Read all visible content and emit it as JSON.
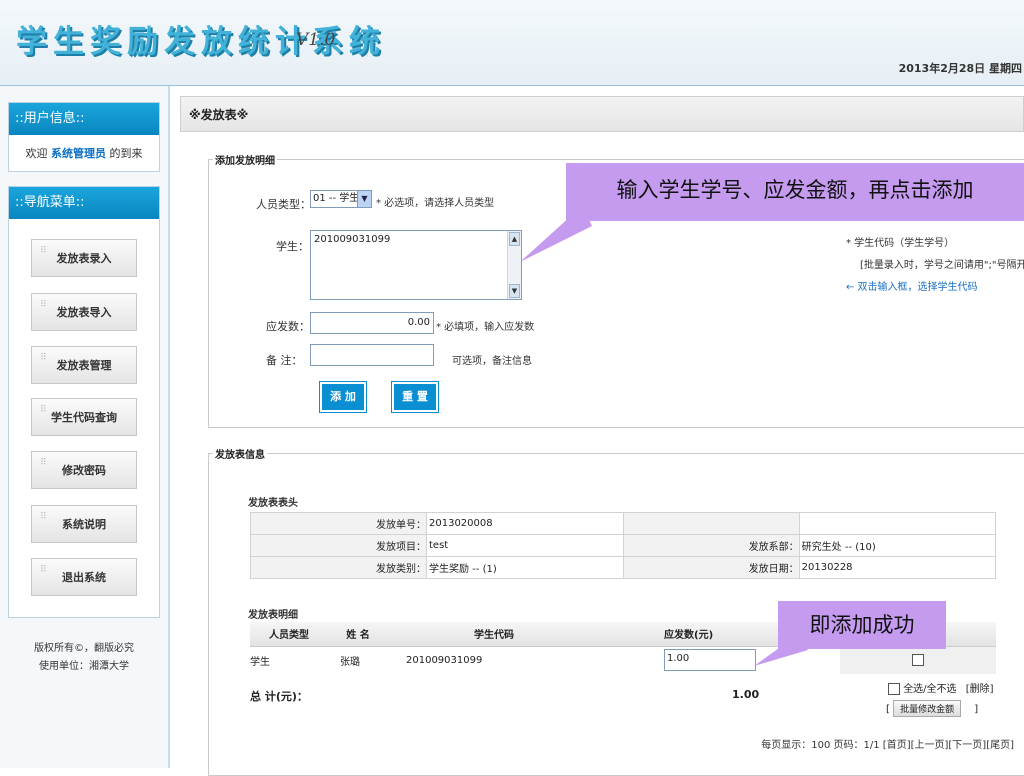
{
  "header": {
    "logo_text": "学生奖励发放统计系统",
    "version": "V1.0",
    "date": "2013年2月28日 星期四"
  },
  "sidebar": {
    "user_info_title": "::用户信息::",
    "welcome_prefix": "欢迎",
    "admin_name": "系统管理员",
    "welcome_suffix": "的到来",
    "nav_title": "::导航菜单::",
    "nav_items": [
      "发放表录入",
      "发放表导入",
      "发放表管理",
      "学生代码查询",
      "修改密码",
      "系统说明",
      "退出系统"
    ],
    "copyright": "版权所有©，翻版必究",
    "unit": "使用单位：湘潭大学"
  },
  "main": {
    "title": "※发放表※",
    "add_section": {
      "legend": "添加发放明细",
      "person_type_label": "人员类型：",
      "person_type_value": "01 -- 学生",
      "person_type_hint": "* 必选项，请选择人员类型",
      "student_label": "学生：",
      "student_value": "201009031099",
      "student_hint_1": "*  学生代码（学生学号）",
      "student_hint_2": "[批量录入时，学号之间请用\";\"号隔开]",
      "student_hint_3": "←  双击输入框，选择学生代码",
      "amount_label": "应发数：",
      "amount_value": "0.00",
      "amount_hint": "* 必填项，输入应发数",
      "remark_label": "备  注：",
      "remark_value": "",
      "remark_hint": "可选项，备注信息",
      "add_button": "添 加",
      "reset_button": "重 置"
    },
    "info_section": {
      "legend": "发放表信息",
      "header_title": "发放表表头",
      "rows": [
        {
          "k1": "发放单号：",
          "v1": "2013020008",
          "k2": "",
          "v2": ""
        },
        {
          "k1": "发放项目：",
          "v1": "test",
          "k2": "发放系部：",
          "v2": "研究生处 -- (10)"
        },
        {
          "k1": "发放类别：",
          "v1": "学生奖励 -- (1)",
          "k2": "发放日期：",
          "v2": "20130228"
        }
      ],
      "detail_title": "发放表明细",
      "columns": [
        "人员类型",
        "姓  名",
        "学生代码",
        "应发数(元)",
        ""
      ],
      "detail_rows": [
        {
          "type": "学生",
          "name": "张璐",
          "code": "201009031099",
          "amount": "1.00"
        }
      ],
      "total_label": "总  计(元)：",
      "total_value": "1.00",
      "select_all": "全选/全不选",
      "delete": "[删除]",
      "batch_edit": "批量修改金额",
      "pagination": "每页显示：100  页码：1/1   [首页][上一页][下一页][尾页]"
    },
    "callouts": {
      "top": "输入学生学号、应发金额，再点击添加",
      "bottom": "即添加成功"
    }
  }
}
